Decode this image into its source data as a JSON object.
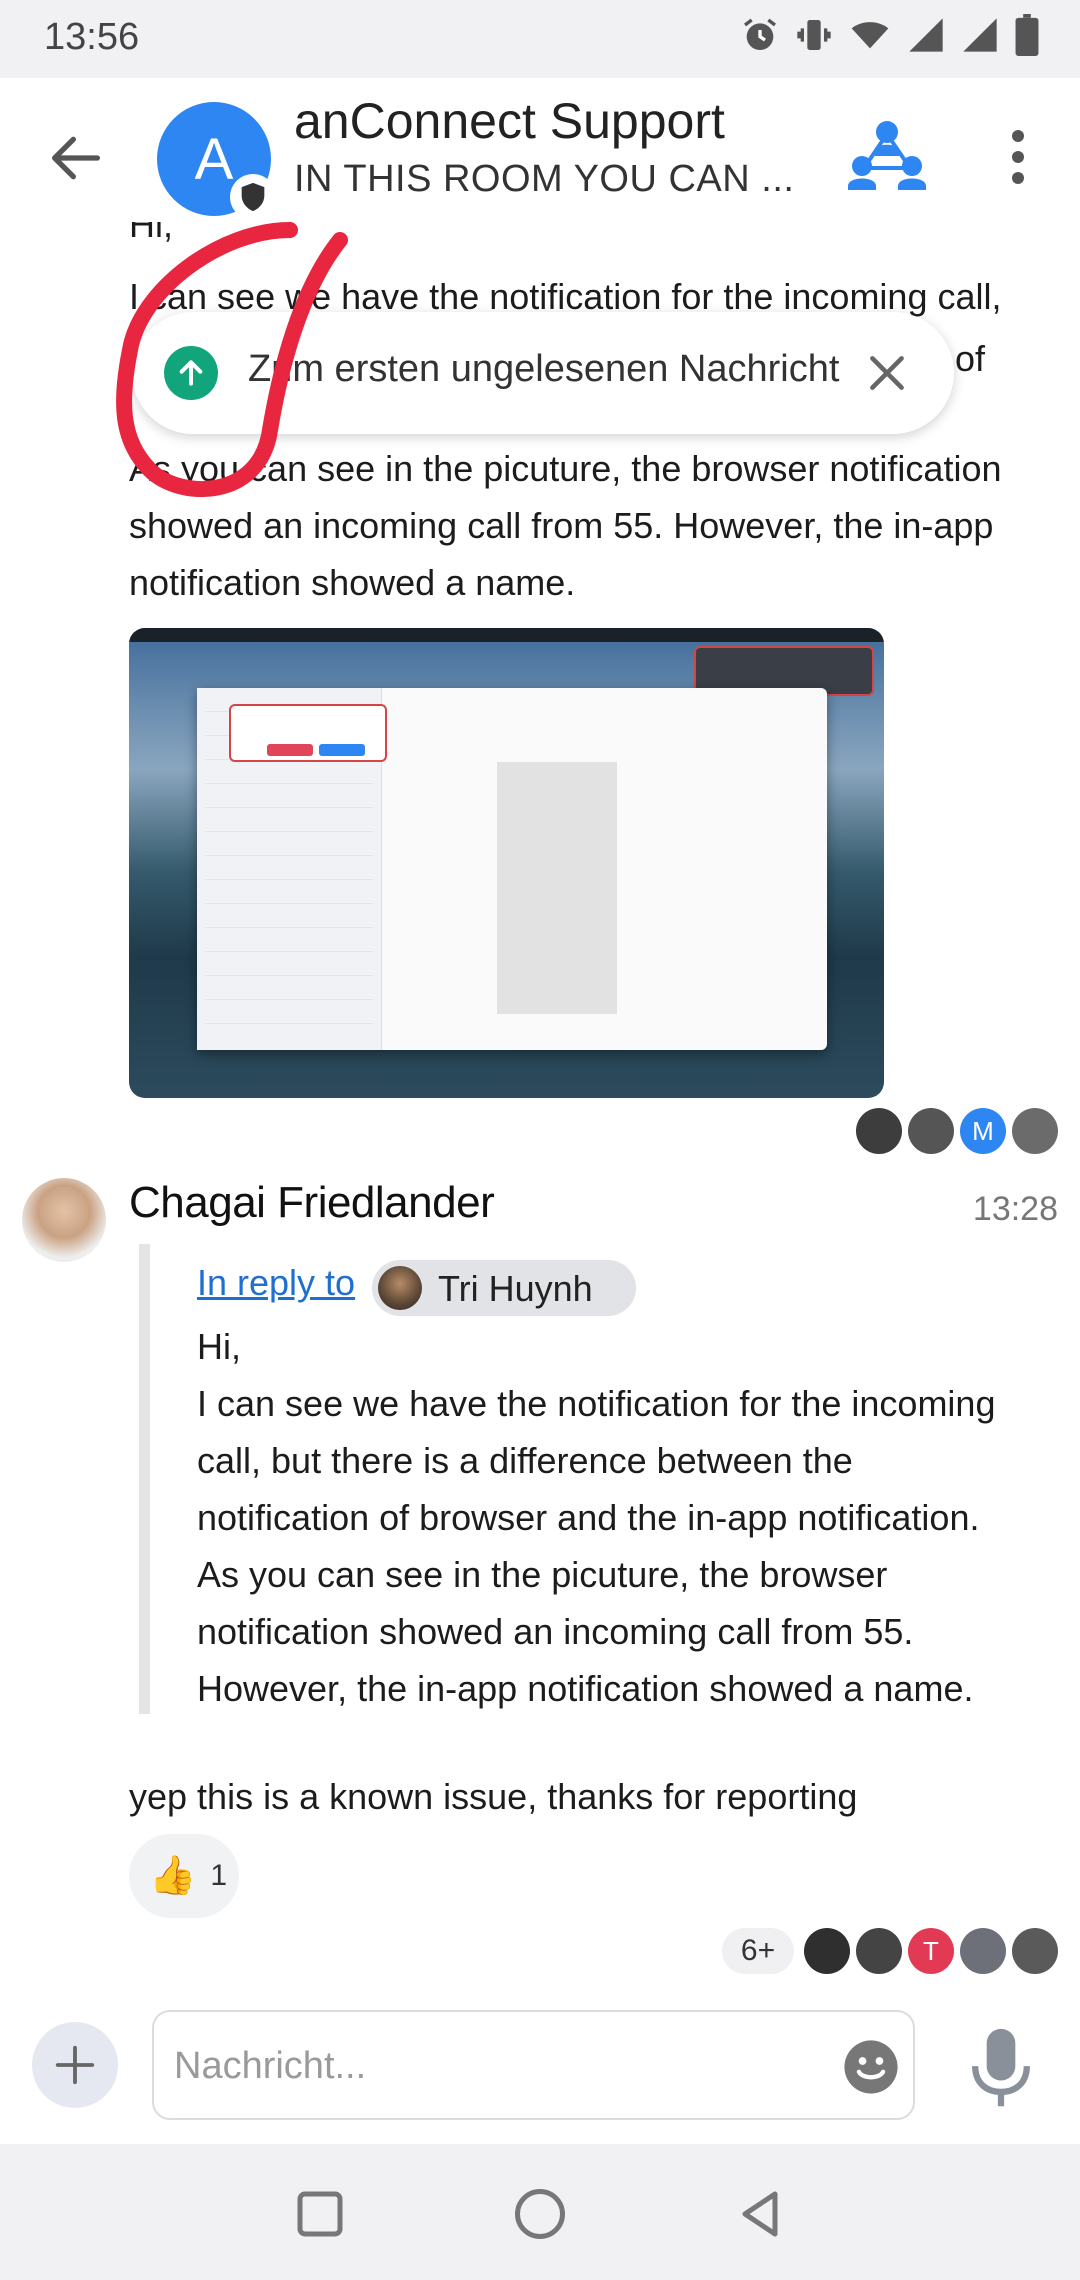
{
  "status_bar": {
    "time": "13:56",
    "icons": [
      "alarm-icon",
      "vibrate-icon",
      "wifi-icon",
      "signal-icon",
      "signal-icon",
      "battery-icon"
    ]
  },
  "header": {
    "avatar_letter": "A",
    "title": "anConnect Support",
    "topic": "IN THIS ROOM YOU CAN ...",
    "icons": [
      "back-arrow-icon",
      "shield-icon",
      "group-call-icon",
      "more-vertical-icon"
    ]
  },
  "timeline": {
    "partial_top_line": "Hi,",
    "first_message_lines": [
      "I can see we have the notification for the incoming call,",
      "As you can see in the picuture, the browser notification",
      "showed an incoming call from 55. However, the in-app",
      "notification showed a name."
    ],
    "clipped_fragment": "of",
    "jump_to_unread": "Zum ersten ungelesenen Nachricht",
    "read_receipts_1": [
      {
        "initial": "",
        "color": "#3d3d3d"
      },
      {
        "initial": "",
        "color": "#555555"
      },
      {
        "initial": "M",
        "color": "#2d86f2"
      },
      {
        "initial": "",
        "color": "#6b6b6b"
      }
    ]
  },
  "message2": {
    "sender": "Chagai Friedlander",
    "time": "13:28",
    "reply_link": "In reply to",
    "reply_to": "Tri Huynh",
    "quote_lines": [
      "Hi,",
      "I can see we have the notification for the incoming",
      "call, but there is a difference between the",
      "notification of browser and the in-app notification.",
      "As you can see in the picuture, the browser",
      "notification showed an incoming call from 55.",
      "However, the in-app notification showed a name."
    ],
    "body": "yep this is a known issue, thanks for reporting",
    "reaction": {
      "emoji": "👍",
      "count": "1"
    },
    "read_receipts_more": "6+",
    "read_receipts_2": [
      {
        "initial": "",
        "color": "#2f2f2f"
      },
      {
        "initial": "",
        "color": "#444444"
      },
      {
        "initial": "T",
        "color": "#e23a54"
      },
      {
        "initial": "",
        "color": "#6d7078"
      },
      {
        "initial": "",
        "color": "#5a5a5a"
      }
    ]
  },
  "composer": {
    "placeholder": "Nachricht...",
    "icons": [
      "plus-icon",
      "emoji-icon",
      "microphone-icon"
    ]
  },
  "colors": {
    "accent": "#2d86f2",
    "green": "#12a57b",
    "annotation_red": "#e8263f",
    "link": "#1f6fd1"
  }
}
